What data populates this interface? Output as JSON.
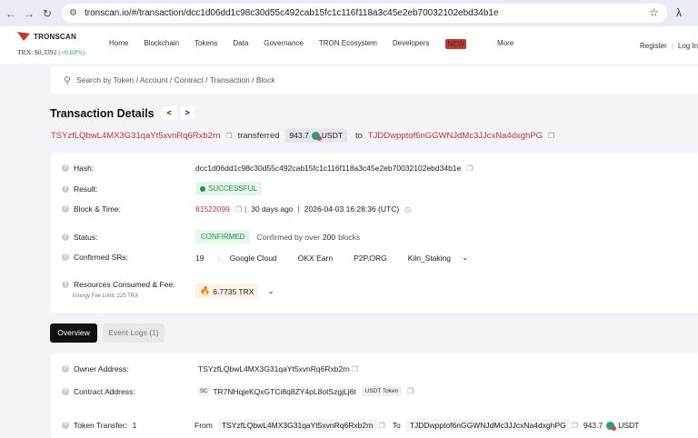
{
  "browser": {
    "url": "tronscan.io/#/transaction/dcc1d06dd1c98c30d55c492cab15fc1c116f118a3c45e2eb70032102ebd34b1e",
    "icons": [
      "back-arrow-icon",
      "forward-arrow-icon",
      "reload-icon",
      "site-settings-icon",
      "star-icon",
      "extension-icon"
    ]
  },
  "header": {
    "logo_text": "TRONSCAN",
    "price_label": "TRX: $0.3392",
    "price_change": "(+0.69%)",
    "menu": [
      "Home",
      "Blockchain",
      "Tokens",
      "Data",
      "Governance",
      "TRON Ecosystem",
      "Developers",
      "More"
    ],
    "new_badge": "NEW",
    "register": "Register",
    "login": "Log In"
  },
  "search": {
    "placeholder": "Search by Token / Account / Contract / Transaction / Block"
  },
  "page": {
    "title": "Transaction Details",
    "prev": "<",
    "next": ">",
    "from_address": "TSYzfLQbwL4MX3G31qaYt5xvnRq6Rxb2rn",
    "transferred_word": "transferred",
    "amount": "943.7",
    "token": "USDT",
    "to_word": "to",
    "to_address": "TJDDwpptof6nGGWNJdMc3JJcxNa4dxghPG"
  },
  "details": {
    "hash_label": "Hash:",
    "hash_value": "dcc1d06dd1c98c30d55c492cab15fc1c116f118a3c45e2eb70032102ebd34b1e",
    "result_label": "Result:",
    "result_value": "SUCCESSFUL",
    "block_label": "Block & Time:",
    "block_number": "81522099",
    "block_age": "30 days ago",
    "block_time": "2026-04-03 16:28:36 (UTC)",
    "status_label": "Status:",
    "status_value": "CONFIRMED",
    "status_note_prefix": "Confirmed by over",
    "status_note_count": "200",
    "status_note_suffix": "blocks",
    "srs_label": "Confirmed SRs:",
    "srs_count": "19",
    "srs": [
      "Google Cloud",
      "OKX Earn",
      "P2P.ORG",
      "Kiln_Staking"
    ],
    "resources_label": "Resources Consumed & Fee:",
    "energy_limit": "Energy Fee Limit: 225 TRX",
    "fee_value": "6.7735 TRX"
  },
  "tabs": {
    "overview": "Overview",
    "event_logs": "Event Logs (1)"
  },
  "overview": {
    "owner_label": "Owner Address:",
    "owner_value": "TSYzfLQbwL4MX3G31qaYt5xvnRq6Rxb2rn",
    "contract_label": "Contract Address:",
    "contract_sc": "SC",
    "contract_value": "TR7NHqjeKQxGTCi8q8ZY4pL8otSzgjLj6t",
    "contract_tag": "USDT Token",
    "transfer_label": "Token Transfer:",
    "transfer_count": "1",
    "from_word": "From",
    "from_value": "TSYzfLQbwL4MX3G31qaYt5xvnRq6Rxb2rn",
    "to_word": "To",
    "to_value": "TJDDwpptof6nGGWNJdMc3JJcxNa4dxghPG",
    "amount": "943.7",
    "token": "USDT"
  }
}
